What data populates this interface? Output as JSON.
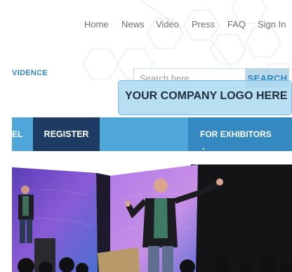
{
  "nav": {
    "items": [
      "Home",
      "News",
      "Video",
      "Press",
      "FAQ",
      "Sign In"
    ]
  },
  "brand": {
    "text": "VIDENCE"
  },
  "search": {
    "placeholder": "Search here...",
    "button_label": "SEARCH"
  },
  "logo_banner": {
    "text": "YOUR COMPANY LOGO HERE"
  },
  "main_nav": {
    "partial_item": "EL",
    "register": "REGISTER",
    "exhibitors": "FOR EXHIBITORS"
  },
  "colors": {
    "nav_bar": "#4ea7d8",
    "register_bg": "#1d3b63",
    "exhibitors_bg": "#3589c1",
    "accent_text": "#2f86c3"
  }
}
